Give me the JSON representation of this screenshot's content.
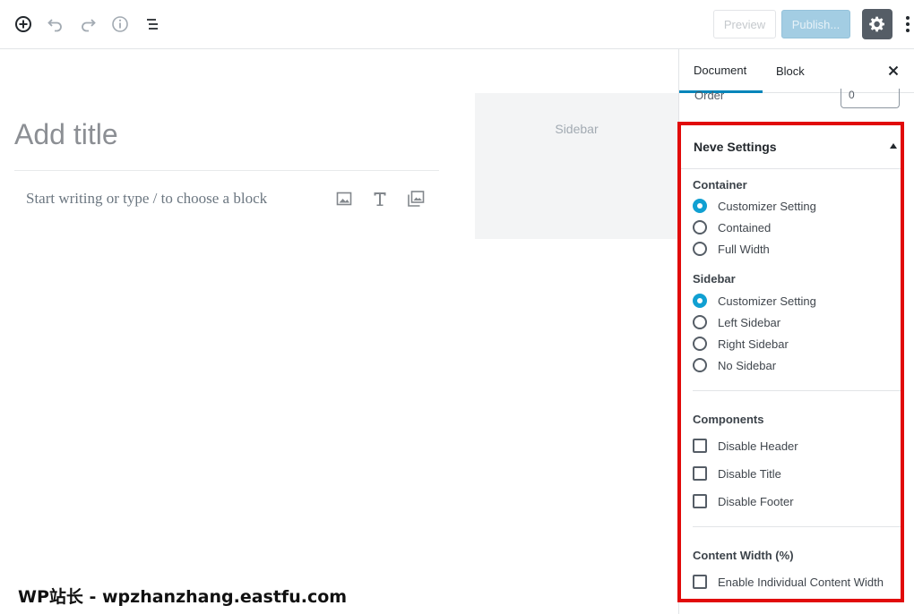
{
  "toolbar": {
    "icons": [
      "add-block-icon",
      "undo-icon",
      "redo-icon",
      "info-icon",
      "list-view-icon"
    ],
    "preview_label": "Preview",
    "publish_label": "Publish...",
    "settings_icon": "gear-icon",
    "more_icon": "more-vertical-icon"
  },
  "editor": {
    "title_placeholder": "Add title",
    "block_placeholder": "Start writing or type / to choose a block",
    "inserter_icons": [
      "image-icon",
      "heading-icon",
      "gallery-icon"
    ],
    "sidebar_placeholder": "Sidebar"
  },
  "settings": {
    "tabs": [
      {
        "label": "Document",
        "active": true
      },
      {
        "label": "Block",
        "active": false
      }
    ],
    "order_label": "Order",
    "order_value": "0",
    "neve": {
      "title": "Neve Settings",
      "container": {
        "label": "Container",
        "options": [
          {
            "label": "Customizer Setting",
            "checked": true
          },
          {
            "label": "Contained",
            "checked": false
          },
          {
            "label": "Full Width",
            "checked": false
          }
        ]
      },
      "sidebar": {
        "label": "Sidebar",
        "options": [
          {
            "label": "Customizer Setting",
            "checked": true
          },
          {
            "label": "Left Sidebar",
            "checked": false
          },
          {
            "label": "Right Sidebar",
            "checked": false
          },
          {
            "label": "No Sidebar",
            "checked": false
          }
        ]
      },
      "components": {
        "label": "Components",
        "options": [
          {
            "label": "Disable Header",
            "checked": false
          },
          {
            "label": "Disable Title",
            "checked": false
          },
          {
            "label": "Disable Footer",
            "checked": false
          }
        ]
      },
      "content_width": {
        "label": "Content Width (%)",
        "options": [
          {
            "label": "Enable Individual Content Width",
            "checked": false
          }
        ]
      }
    }
  },
  "colors": {
    "accent": "#11a0d2",
    "tab_underline": "#0085ba",
    "highlight": "#e10a0a",
    "publish_bg": "#a3cde3"
  },
  "watermark": "WP站长 - wpzhanzhang.eastfu.com"
}
